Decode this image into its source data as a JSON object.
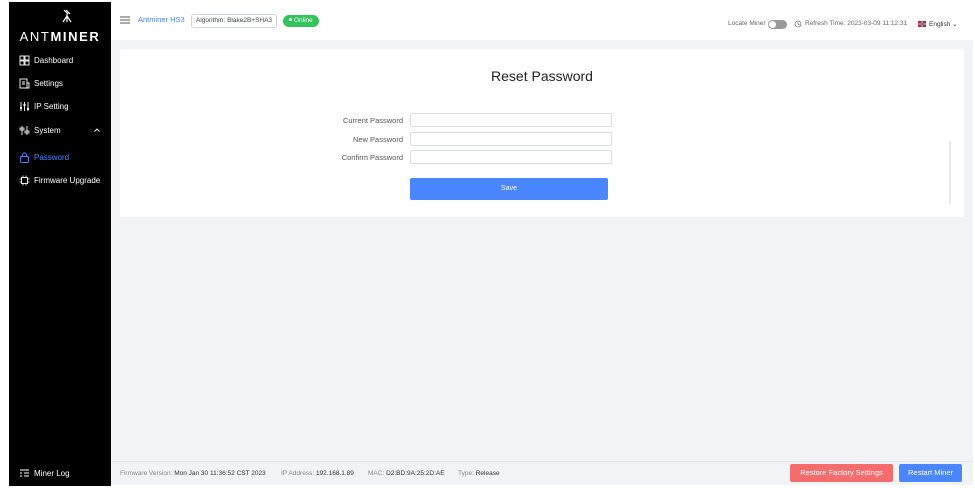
{
  "sidebar": {
    "logo": {
      "prefix": "ANT",
      "suffix": "MINER"
    },
    "items": [
      {
        "label": "Dashboard",
        "icon": "dashboard-icon"
      },
      {
        "label": "Settings",
        "icon": "settings-icon"
      },
      {
        "label": "IP Setting",
        "icon": "sliders-icon"
      },
      {
        "label": "System",
        "icon": "system-icon",
        "expanded": true
      },
      {
        "label": "Password",
        "icon": "lock-icon",
        "active": true
      },
      {
        "label": "Firmware Upgrade",
        "icon": "chip-icon"
      }
    ],
    "miner_log": "Miner Log"
  },
  "header": {
    "brand": "Antminer HS3",
    "algorithm": "Algorithm: Blake2B+SHA3",
    "status": "Online",
    "locate_label": "Locate Miner",
    "refresh": "Refresh Time: 2023-03-09 11:12:31",
    "language": "English"
  },
  "form": {
    "title": "Reset Password",
    "fields": [
      {
        "label": "Current Password",
        "value": ""
      },
      {
        "label": "New Password",
        "value": ""
      },
      {
        "label": "Confirm Password",
        "value": ""
      }
    ],
    "save_label": "Save"
  },
  "footer": {
    "firmware_label": "Firmware Version:",
    "firmware": "Mon Jan 30 11:36:52 CST 2023",
    "ip_label": "IP Address:",
    "ip": "192.168.1.89",
    "mac_label": "MAC:",
    "mac": "D2:BD:9A:25:2D:AE",
    "type_label": "Type:",
    "type": "Release",
    "restore_label": "Restore Factory Settings",
    "restart_label": "Restart Miner"
  },
  "colors": {
    "accent": "#4a86ff",
    "online": "#33c35c",
    "danger": "#f56c6c",
    "sidebar": "#000000",
    "background": "#f2f3f5"
  }
}
